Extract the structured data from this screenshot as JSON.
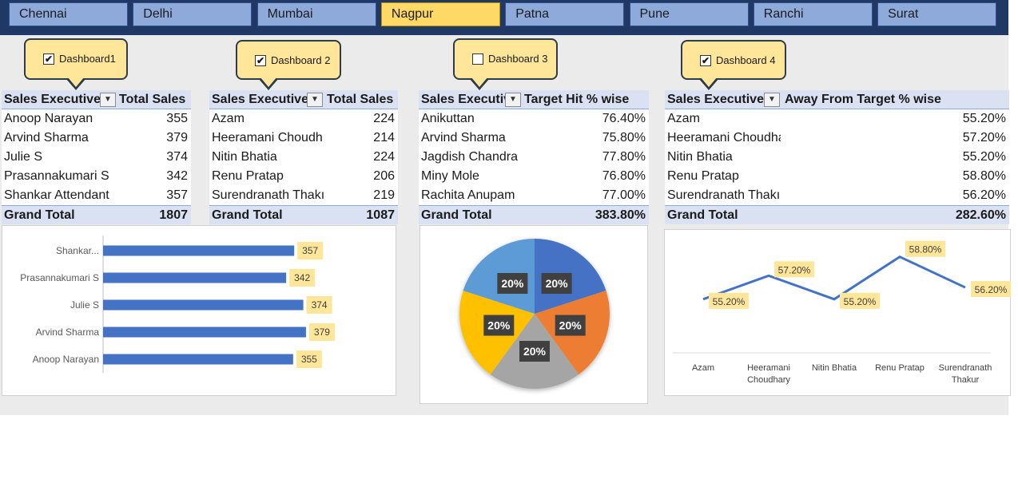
{
  "slicer": {
    "items": [
      "Chennai",
      "Delhi",
      "Mumbai",
      "Nagpur",
      "Patna",
      "Pune",
      "Ranchi",
      "Surat"
    ],
    "selected": "Nagpur"
  },
  "callouts": [
    {
      "label": "Dashboard1",
      "checked": true,
      "check_glyph": "✔"
    },
    {
      "label": "Dashboard 2",
      "checked": true,
      "check_glyph": "✔"
    },
    {
      "label": "Dashboard 3",
      "checked": false,
      "check_glyph": ""
    },
    {
      "label": "Dashboard 4",
      "checked": true,
      "check_glyph": "✔"
    }
  ],
  "pivots": [
    {
      "col1": "Sales Executive",
      "col2": "Total Sales",
      "rows": [
        [
          "Anoop Narayan",
          "355"
        ],
        [
          "Arvind Sharma",
          "379"
        ],
        [
          "Julie S",
          "374"
        ],
        [
          "Prasannakumari S",
          "342"
        ],
        [
          "Shankar Attendant",
          "357"
        ]
      ],
      "total_label": "Grand Total",
      "total_value": "1807"
    },
    {
      "col1": "Sales Executive",
      "col2": "Total Sales",
      "rows": [
        [
          "Azam",
          "224"
        ],
        [
          "Heeramani Choudh",
          "214"
        ],
        [
          "Nitin Bhatia",
          "224"
        ],
        [
          "Renu Pratap",
          "206"
        ],
        [
          "Surendranath Thakı",
          "219"
        ]
      ],
      "total_label": "Grand Total",
      "total_value": "1087"
    },
    {
      "col1": "Sales Executiv",
      "col2": "Target Hit % wise",
      "rows": [
        [
          "Anikuttan",
          "76.40%"
        ],
        [
          "Arvind Sharma",
          "75.80%"
        ],
        [
          "Jagdish Chandra",
          "77.80%"
        ],
        [
          "Miny Mole",
          "76.80%"
        ],
        [
          "Rachita Anupam",
          "77.00%"
        ]
      ],
      "total_label": "Grand Total",
      "total_value": "383.80%"
    },
    {
      "col1": "Sales Executive",
      "col2": "Away From Target % wise",
      "rows": [
        [
          "Azam",
          "55.20%"
        ],
        [
          "Heeramani Choudha",
          "57.20%"
        ],
        [
          "Nitin Bhatia",
          "55.20%"
        ],
        [
          "Renu Pratap",
          "58.80%"
        ],
        [
          "Surendranath Thakı",
          "56.20%"
        ]
      ],
      "total_label": "Grand Total",
      "total_value": "282.60%"
    }
  ],
  "colors": {
    "accent": "#4472c4",
    "selected": "#ffd966",
    "label_bg": "#ffe699",
    "pie": [
      "#4472c4",
      "#ed7d31",
      "#a5a5a5",
      "#ffc000",
      "#5b9bd5"
    ]
  },
  "chart_data": [
    {
      "type": "bar",
      "categories": [
        "Anoop Narayan",
        "Arvind Sharma",
        "Julie S",
        "Prasannakumari S",
        "Shankar Attendant"
      ],
      "category_labels": [
        "Anoop Narayan",
        "Arvind Sharma",
        "Julie S",
        "Prasannakumari S",
        "Shankar..."
      ],
      "values": [
        355,
        379,
        374,
        342,
        357
      ],
      "value_labels": [
        "355",
        "379",
        "374",
        "342",
        "357"
      ],
      "orientation": "horizontal",
      "xlim": [
        0,
        400
      ],
      "grid": false
    },
    {
      "type": "pie",
      "values": [
        20,
        20,
        20,
        20,
        20
      ],
      "value_labels": [
        "20%",
        "20%",
        "20%",
        "20%",
        "20%"
      ]
    },
    {
      "type": "line",
      "categories": [
        "Azam",
        "Heeramani Choudhary",
        "Nitin Bhatia",
        "Renu Pratap",
        "Surendranath Thakur"
      ],
      "category_lines": [
        [
          "Azam"
        ],
        [
          "Heeramani",
          "Choudhary"
        ],
        [
          "Nitin Bhatia"
        ],
        [
          "Renu Pratap"
        ],
        [
          "Surendranath",
          "Thakur"
        ]
      ],
      "values": [
        55.2,
        57.2,
        55.2,
        58.8,
        56.2
      ],
      "value_labels": [
        "55.20%",
        "57.20%",
        "55.20%",
        "58.80%",
        "56.20%"
      ],
      "ylim": [
        52,
        60
      ],
      "grid": false
    }
  ]
}
